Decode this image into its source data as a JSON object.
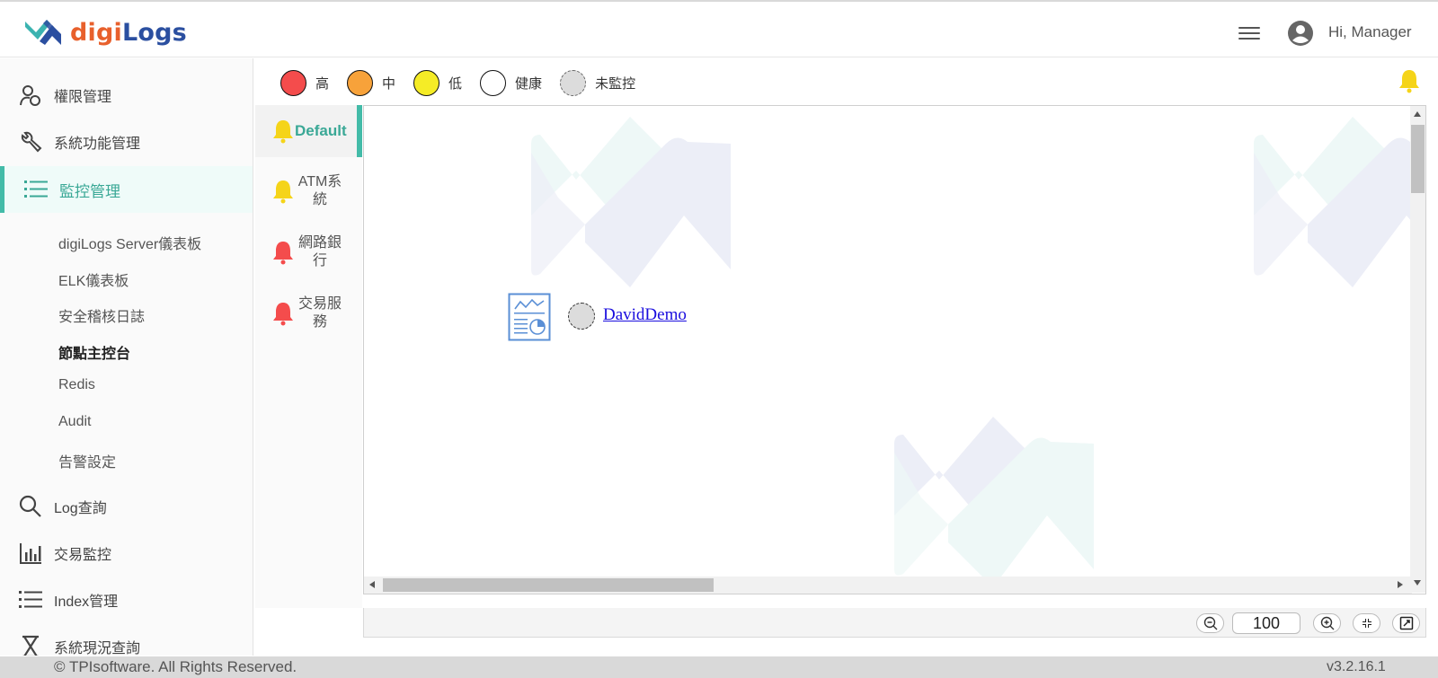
{
  "app": {
    "logo_part1": "digi",
    "logo_part2": "Logs",
    "greeting": "Hi, Manager"
  },
  "sidebar": {
    "items": [
      {
        "label": "權限管理",
        "icon": "users-icon"
      },
      {
        "label": "系統功能管理",
        "icon": "wrench-icon"
      },
      {
        "label": "監控管理",
        "icon": "list-icon",
        "active": true
      },
      {
        "label": "Log查詢",
        "icon": "search-icon"
      },
      {
        "label": "交易監控",
        "icon": "bar-chart-icon"
      },
      {
        "label": "Index管理",
        "icon": "list-icon"
      },
      {
        "label": "系統現況查詢",
        "icon": "hourglass-icon"
      }
    ],
    "sub_items": [
      "digiLogs Server儀表板",
      "ELK儀表板",
      "安全稽核日誌",
      "節點主控台",
      "Redis",
      "Audit",
      "告警設定"
    ],
    "current_sub_item": "節點主控台"
  },
  "legend": {
    "items": [
      {
        "label": "高",
        "color": "#f44c4c"
      },
      {
        "label": "中",
        "color": "#f7a23a"
      },
      {
        "label": "低",
        "color": "#f5ec26"
      },
      {
        "label": "健康",
        "color": "#ffffff"
      },
      {
        "label": "未監控",
        "color": "#dcdcdc"
      }
    ]
  },
  "tabs": [
    {
      "label": "Default",
      "bell_color": "#f5d419",
      "active": true
    },
    {
      "label": "ATM系統",
      "bell_color": "#f5d419"
    },
    {
      "label": "網路銀行",
      "bell_color": "#f44c4c"
    },
    {
      "label": "交易服務",
      "bell_color": "#f44c4c"
    }
  ],
  "canvas": {
    "node": {
      "name": "DavidDemo",
      "status": "未監控"
    }
  },
  "zoom": {
    "value": "100"
  },
  "footer": {
    "copyright": "© TPIsoftware. All Rights Reserved.",
    "version": "v3.2.16.1"
  },
  "colors": {
    "accent": "#43bba8",
    "link": "#1a0dde"
  }
}
